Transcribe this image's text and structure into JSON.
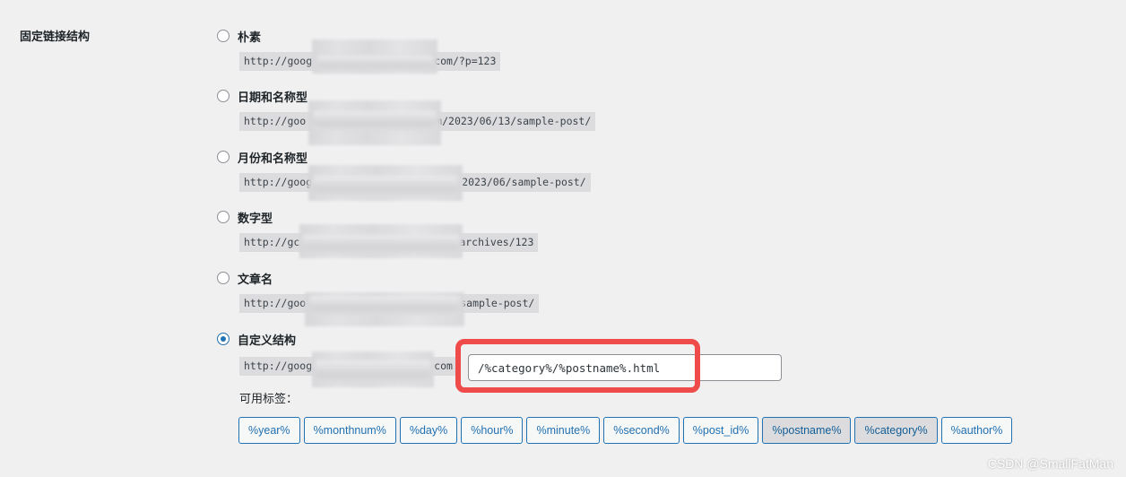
{
  "section": {
    "label": "固定链接结构"
  },
  "options": [
    {
      "id": "plain",
      "label": "朴素",
      "example_left": "http://goog",
      "example_right": "com/?p=123",
      "checked": false
    },
    {
      "id": "day-name",
      "label": "日期和名称型",
      "example_left": "http://goo",
      "example_right": "om/2023/06/13/sample-post/",
      "checked": false
    },
    {
      "id": "month-name",
      "label": "月份和名称型",
      "example_left": "http://goog",
      "example_right": "2023/06/sample-post/",
      "checked": false
    },
    {
      "id": "numeric",
      "label": "数字型",
      "example_left": "http://gc",
      "example_right": "archives/123",
      "checked": false
    },
    {
      "id": "post-name",
      "label": "文章名",
      "example_left": "http://goo",
      "example_right": "sample-post/",
      "checked": false
    },
    {
      "id": "custom",
      "label": "自定义结构",
      "example_left": "http://goog",
      "example_right": "com",
      "checked": true
    }
  ],
  "custom_structure": {
    "value": "/%category%/%postname%.html"
  },
  "available_tags": {
    "label": "可用标签：",
    "tags": [
      {
        "label": "%year%",
        "active": false
      },
      {
        "label": "%monthnum%",
        "active": false
      },
      {
        "label": "%day%",
        "active": false
      },
      {
        "label": "%hour%",
        "active": false
      },
      {
        "label": "%minute%",
        "active": false
      },
      {
        "label": "%second%",
        "active": false
      },
      {
        "label": "%post_id%",
        "active": false
      },
      {
        "label": "%postname%",
        "active": true
      },
      {
        "label": "%category%",
        "active": true
      },
      {
        "label": "%author%",
        "active": false
      }
    ]
  },
  "colors": {
    "accent": "#2271b1",
    "highlight": "#ef4b4b",
    "background": "#f0f0f1"
  },
  "watermark": "CSDN @SmallFatMan"
}
